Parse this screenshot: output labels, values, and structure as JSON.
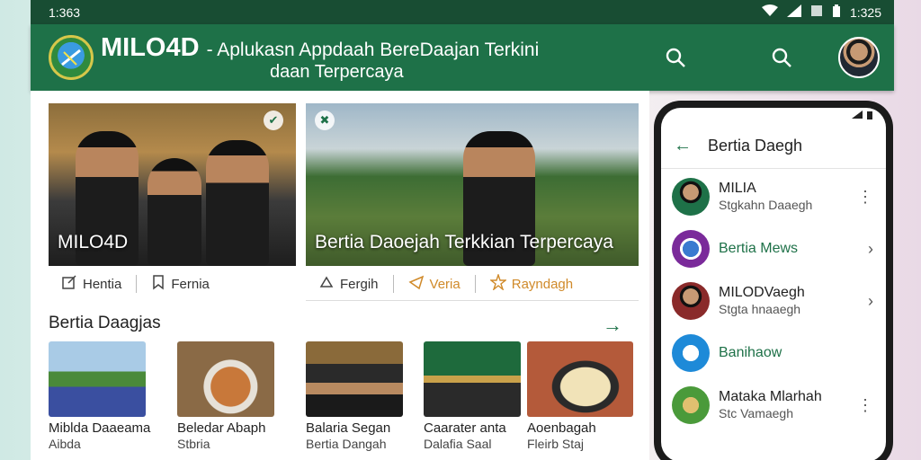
{
  "status_bar": {
    "time_left": "1:363",
    "time_right": "1:325"
  },
  "app_bar": {
    "brand": "MILO4D",
    "tagline_line1": "- Aplukasn Appdaah BereDaajan Terkini",
    "tagline_line2": "daan Terpercaya",
    "colors": {
      "primary": "#1e7148",
      "status": "#184d33"
    }
  },
  "hero": {
    "left_caption": "MILO4D",
    "right_caption": "Bertia Daoejah Terkkian Terpercaya"
  },
  "actions_left": [
    {
      "label": "Hentia",
      "icon": "edit-icon"
    },
    {
      "label": "Fernia",
      "icon": "bookmark-icon"
    }
  ],
  "actions_right": [
    {
      "label": "Fergih",
      "icon": "pin-icon"
    },
    {
      "label": "Veria",
      "icon": "share-icon"
    },
    {
      "label": "Rayndagh",
      "icon": "star-icon"
    }
  ],
  "section": {
    "title": "Bertia Daagjas"
  },
  "thumbnails": [
    {
      "line1": "Miblda Daaeama",
      "line2": "Aibda"
    },
    {
      "line1": "Beledar Abaph",
      "line2": "Stbria"
    },
    {
      "line1": "Balaria Segan",
      "line2": "Bertia Dangah"
    },
    {
      "line1": "Caarater anta",
      "line2": "Dalafia Saal"
    },
    {
      "line1": "Aoenbagah",
      "line2": "Fleirb Staj"
    }
  ],
  "phone": {
    "title": "Bertia Daegh",
    "chats": [
      {
        "name": "MILIA",
        "sub": "Stgkahn Daaegh",
        "trail": "more-vert"
      },
      {
        "name": "Bertia Mews",
        "sub": "",
        "trail": "chevron"
      },
      {
        "name": "MILODVaegh",
        "sub": "Stgta hnaaegh",
        "trail": "chevron"
      },
      {
        "name": "Banihaow",
        "sub": "",
        "trail": ""
      },
      {
        "name": "Mataka Mlarhah",
        "sub": "Stc Vamaegh",
        "trail": "more-vert"
      }
    ]
  }
}
